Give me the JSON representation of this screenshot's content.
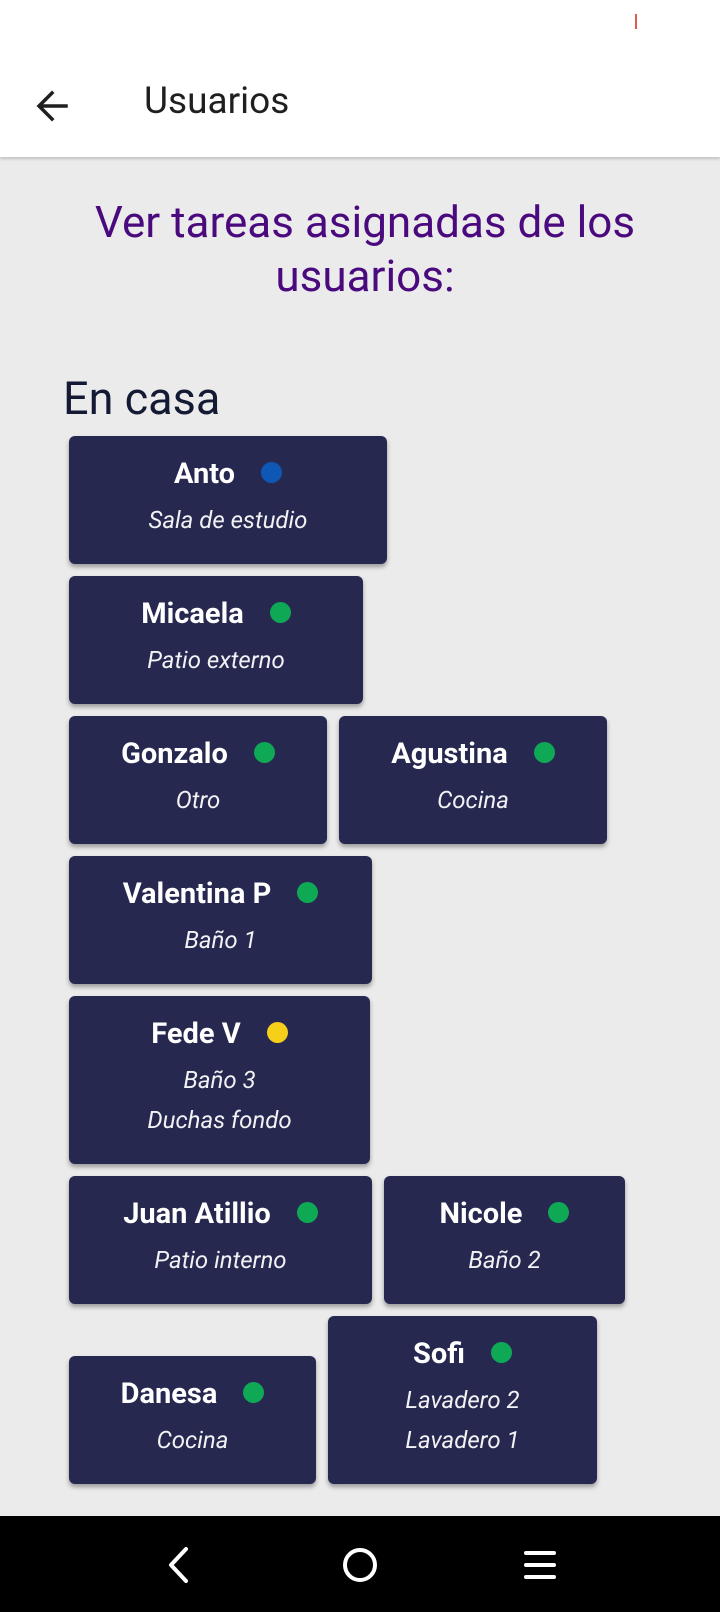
{
  "app_bar": {
    "title": "Usuarios"
  },
  "heading": "Ver tareas asignadas de los usuarios:",
  "section": {
    "title": "En casa"
  },
  "colors": {
    "blue": "#0f57b5",
    "green": "#0fa855",
    "yellow": "#f6cf1a"
  },
  "users": [
    {
      "name": "Anto",
      "status_color": "#0f57b5",
      "locations": [
        "Sala de estudio"
      ]
    },
    {
      "name": "Micaela",
      "status_color": "#0fa855",
      "locations": [
        "Patio externo"
      ]
    },
    {
      "name": "Gonzalo",
      "status_color": "#0fa855",
      "locations": [
        "Otro"
      ]
    },
    {
      "name": "Agustina",
      "status_color": "#0fa855",
      "locations": [
        "Cocina"
      ]
    },
    {
      "name": "Valentina P",
      "status_color": "#0fa855",
      "locations": [
        "Baño 1"
      ]
    },
    {
      "name": "Fede V",
      "status_color": "#f6cf1a",
      "locations": [
        "Baño 3",
        "Duchas fondo"
      ]
    },
    {
      "name": "Juan Atillio",
      "status_color": "#0fa855",
      "locations": [
        "Patio interno"
      ]
    },
    {
      "name": "Nicole",
      "status_color": "#0fa855",
      "locations": [
        "Baño 2"
      ]
    },
    {
      "name": "Danesa",
      "status_color": "#0fa855",
      "locations": [
        "Cocina"
      ]
    },
    {
      "name": "Sofi",
      "status_color": "#0fa855",
      "locations": [
        "Lavadero 2",
        "Lavadero 1"
      ]
    }
  ],
  "nav": {
    "back": "back-icon",
    "home": "home-icon",
    "menu": "menu-icon"
  }
}
